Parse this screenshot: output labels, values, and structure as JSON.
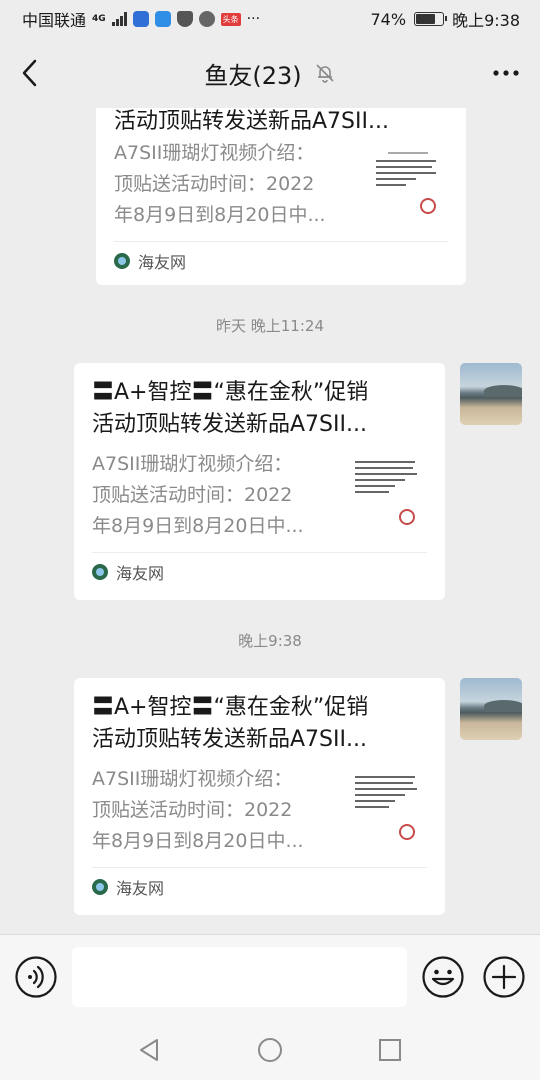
{
  "status": {
    "carrier": "中国联通",
    "network": "4G",
    "badge_text": "头条",
    "more": "···",
    "battery": "74%",
    "battery_level": 0.74,
    "time": "晚上9:38"
  },
  "header": {
    "title": "鱼友(23)",
    "muted": true
  },
  "messages": [
    {
      "title": "活动顶贴转发送新品A7SII...",
      "desc": "A7SII珊瑚灯视频介绍：\n顶贴送活动时间：2022\n年8月9日到8月20日中...",
      "source": "海友网"
    },
    {
      "time": "昨天 晚上11:24",
      "title_line1": "〓A+智控〓“惠在金秋”促销",
      "title_line2": "活动顶贴转发送新品A7SII...",
      "desc": "A7SII珊瑚灯视频介绍：\n顶贴送活动时间：2022\n年8月9日到8月20日中...",
      "source": "海友网"
    },
    {
      "time": "晚上9:38",
      "title_line1": "〓A+智控〓“惠在金秋”促销",
      "title_line2": "活动顶贴转发送新品A7SII...",
      "desc": "A7SII珊瑚灯视频介绍：\n顶贴送活动时间：2022\n年8月9日到8月20日中...",
      "source": "海友网"
    }
  ],
  "input": {
    "value": "",
    "placeholder": ""
  },
  "colors": {
    "background": "#ededed",
    "card": "#ffffff",
    "muted_text": "#8a8a8a"
  },
  "icons": [
    "back-arrow-icon",
    "mute-bell-icon",
    "more-dots-icon",
    "voice-icon",
    "emoji-icon",
    "plus-icon",
    "nav-back-triangle-icon",
    "nav-home-circle-icon",
    "nav-recents-square-icon"
  ]
}
